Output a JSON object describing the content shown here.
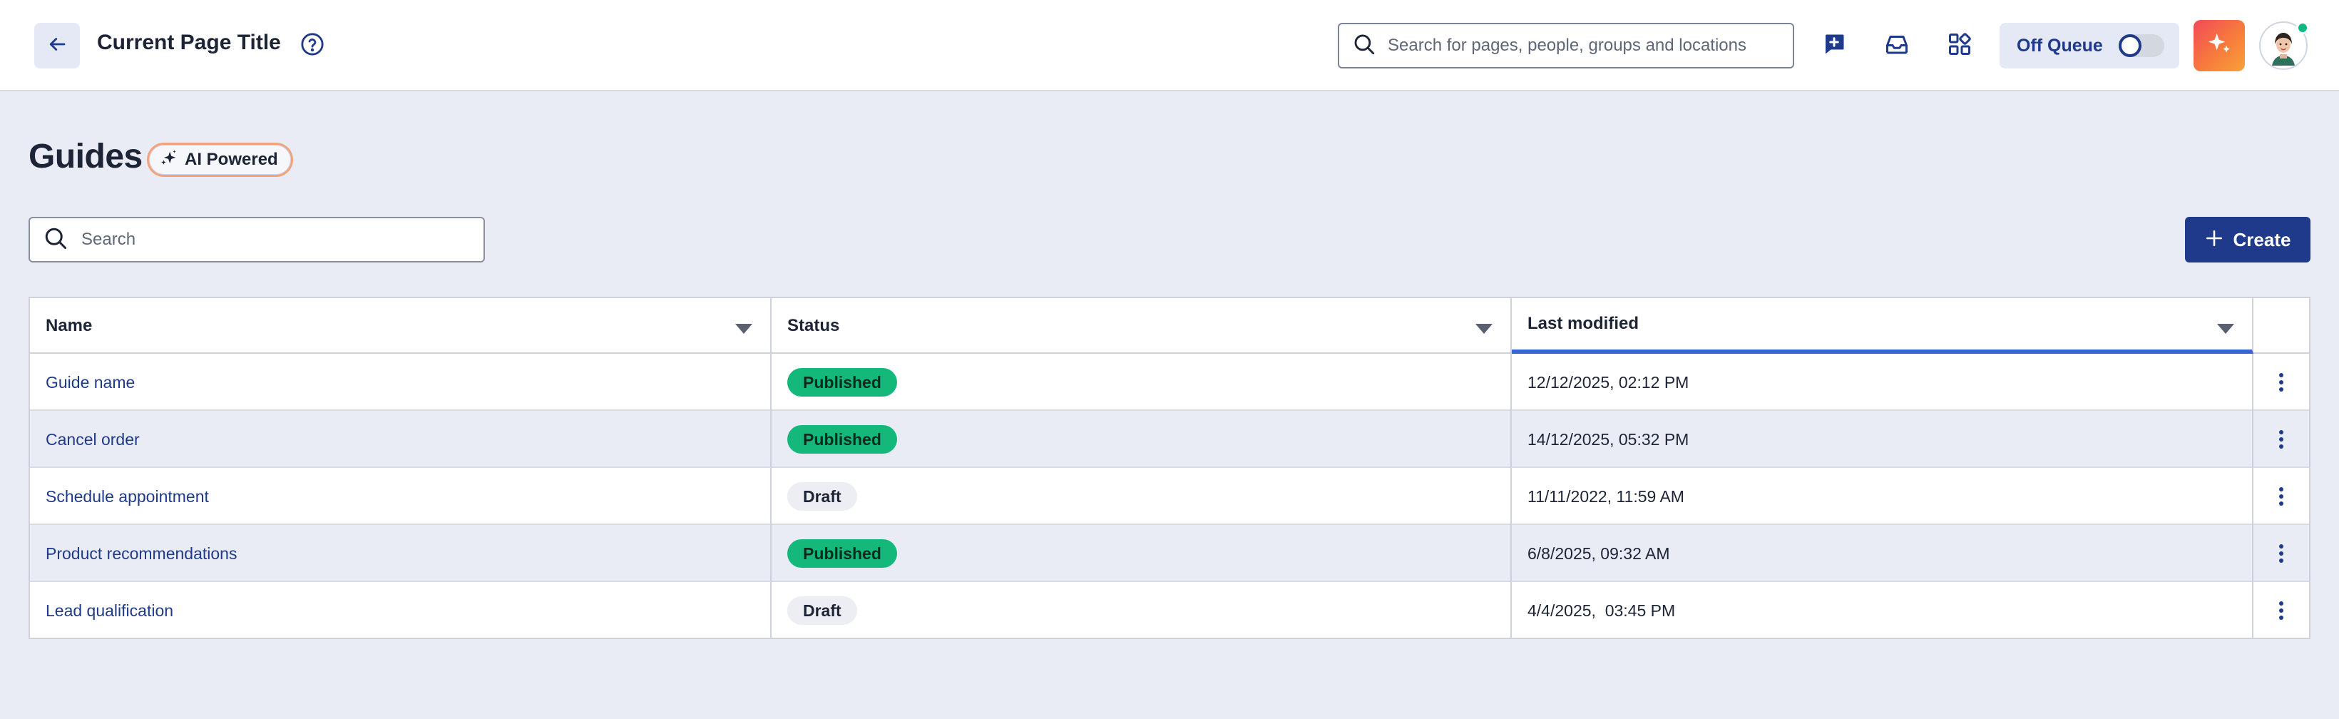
{
  "header": {
    "page_title": "Current Page Title",
    "search_placeholder": "Search for pages, people, groups and locations",
    "queue_label": "Off Queue",
    "queue_on": false
  },
  "guides": {
    "title": "Guides",
    "ai_badge": "AI Powered",
    "search_placeholder": "Search",
    "create_label": "Create"
  },
  "table": {
    "columns": [
      {
        "label": "Name"
      },
      {
        "label": "Status"
      },
      {
        "label": "Last modified"
      }
    ],
    "rows": [
      {
        "name": "Guide name",
        "status": "Published",
        "modified": "12/12/2025, 02:12 PM"
      },
      {
        "name": "Cancel order",
        "status": "Published",
        "modified": "14/12/2025, 05:32 PM"
      },
      {
        "name": "Schedule appointment",
        "status": "Draft",
        "modified": "11/11/2022, 11:59 AM"
      },
      {
        "name": "Product recommendations",
        "status": "Published",
        "modified": "6/8/2025, 09:32 AM"
      },
      {
        "name": "Lead qualification",
        "status": "Draft",
        "modified": "4/4/2025,  03:45 PM"
      }
    ]
  },
  "icons": {
    "back": "arrow-left-icon",
    "help": "question-circle-icon",
    "search": "search-icon",
    "new_message": "message-plus-icon",
    "inbox": "inbox-icon",
    "apps": "apps-grid-icon",
    "ai": "sparkle-icon",
    "sort": "caret-down-icon",
    "row_menu": "more-vertical-icon"
  },
  "colors": {
    "primary": "#1f3a8a",
    "published": "#14b87a",
    "draft": "#eceef3",
    "page_bg": "#e9ecf5",
    "sort_active": "#3a63d6"
  }
}
